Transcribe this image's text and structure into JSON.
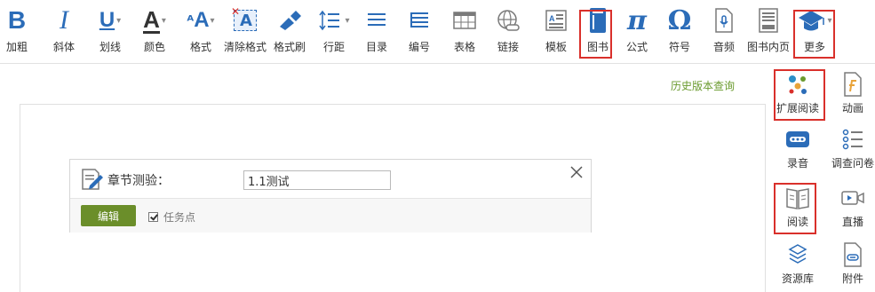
{
  "toolbar": {
    "bold": "加粗",
    "italic": "斜体",
    "underline": "划线",
    "color": "颜色",
    "format": "格式",
    "clear_format": "清除格式",
    "format_brush": "格式刷",
    "line_spacing": "行距",
    "toc": "目录",
    "numbering": "编号",
    "table": "表格",
    "link": "链接",
    "template": "模板",
    "book": "图书",
    "formula": "公式",
    "symbol": "符号",
    "audio": "音频",
    "book_inner_page": "图书内页",
    "more": "更多",
    "glyph_bold": "B",
    "glyph_italic": "I",
    "glyph_underline": "U",
    "glyph_color": "A",
    "glyph_format": "A",
    "glyph_clear": "A",
    "glyph_pi": "π",
    "glyph_omega": "Ω"
  },
  "history_link": "历史版本查询",
  "quiz": {
    "title": "章节测验：",
    "value": "1.1测试",
    "edit_label": "编辑",
    "task_point_label": "任务点",
    "task_point_checked": true
  },
  "side_panel": {
    "extended_reading": "扩展阅读",
    "animation": "动画",
    "recording": "录音",
    "survey": "调查问卷",
    "reading": "阅读",
    "live": "直播",
    "resource_library": "资源库",
    "attachment": "附件"
  },
  "colors": {
    "accent_green": "#6b8e2a",
    "highlight_red": "#d9302b",
    "icon_blue": "#2b6cb8",
    "icon_gray": "#7a7a7a"
  }
}
